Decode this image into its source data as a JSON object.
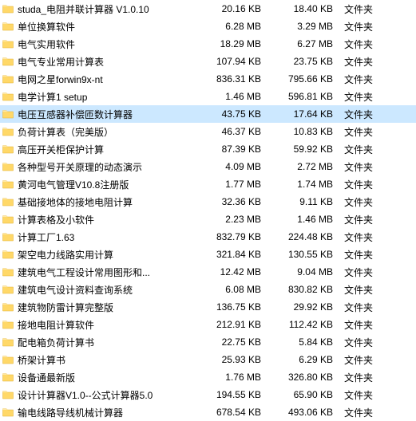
{
  "rows": [
    {
      "name": "studa_电阻并联计算器 V1.0.10",
      "size1": "20.16 KB",
      "size2": "18.40 KB",
      "type": "文件夹",
      "selected": false
    },
    {
      "name": "单位换算软件",
      "size1": "6.28 MB",
      "size2": "3.29 MB",
      "type": "文件夹",
      "selected": false
    },
    {
      "name": "电气实用软件",
      "size1": "18.29 MB",
      "size2": "6.27 MB",
      "type": "文件夹",
      "selected": false
    },
    {
      "name": "电气专业常用计算表",
      "size1": "107.94 KB",
      "size2": "23.75 KB",
      "type": "文件夹",
      "selected": false
    },
    {
      "name": "电网之星forwin9x-nt",
      "size1": "836.31 KB",
      "size2": "795.66 KB",
      "type": "文件夹",
      "selected": false
    },
    {
      "name": "电学计算1 setup",
      "size1": "1.46 MB",
      "size2": "596.81 KB",
      "type": "文件夹",
      "selected": false
    },
    {
      "name": "电压互感器补偿匝数计算器",
      "size1": "43.75 KB",
      "size2": "17.64 KB",
      "type": "文件夹",
      "selected": true
    },
    {
      "name": "负荷计算表（完美版）",
      "size1": "46.37 KB",
      "size2": "10.83 KB",
      "type": "文件夹",
      "selected": false
    },
    {
      "name": "高压开关柜保护计算",
      "size1": "87.39 KB",
      "size2": "59.92 KB",
      "type": "文件夹",
      "selected": false
    },
    {
      "name": "各种型号开关原理的动态演示",
      "size1": "4.09 MB",
      "size2": "2.72 MB",
      "type": "文件夹",
      "selected": false
    },
    {
      "name": "黄河电气管理V10.8注册版",
      "size1": "1.77 MB",
      "size2": "1.74 MB",
      "type": "文件夹",
      "selected": false
    },
    {
      "name": "基础接地体的接地电阻计算",
      "size1": "32.36 KB",
      "size2": "9.11 KB",
      "type": "文件夹",
      "selected": false
    },
    {
      "name": "计算表格及小软件",
      "size1": "2.23 MB",
      "size2": "1.46 MB",
      "type": "文件夹",
      "selected": false
    },
    {
      "name": "计算工厂1.63",
      "size1": "832.79 KB",
      "size2": "224.48 KB",
      "type": "文件夹",
      "selected": false
    },
    {
      "name": "架空电力线路实用计算",
      "size1": "321.84 KB",
      "size2": "130.55 KB",
      "type": "文件夹",
      "selected": false
    },
    {
      "name": "建筑电气工程设计常用图形和...",
      "size1": "12.42 MB",
      "size2": "9.04 MB",
      "type": "文件夹",
      "selected": false
    },
    {
      "name": "建筑电气设计资料查询系统",
      "size1": "6.08 MB",
      "size2": "830.82 KB",
      "type": "文件夹",
      "selected": false
    },
    {
      "name": "建筑物防雷计算完整版",
      "size1": "136.75 KB",
      "size2": "29.92 KB",
      "type": "文件夹",
      "selected": false
    },
    {
      "name": "接地电阻计算软件",
      "size1": "212.91 KB",
      "size2": "112.42 KB",
      "type": "文件夹",
      "selected": false
    },
    {
      "name": "配电箱负荷计算书",
      "size1": "22.75 KB",
      "size2": "5.84 KB",
      "type": "文件夹",
      "selected": false
    },
    {
      "name": "桥架计算书",
      "size1": "25.93 KB",
      "size2": "6.29 KB",
      "type": "文件夹",
      "selected": false
    },
    {
      "name": "设备通最新版",
      "size1": "1.76 MB",
      "size2": "326.80 KB",
      "type": "文件夹",
      "selected": false
    },
    {
      "name": "设计计算器V1.0--公式计算器5.0",
      "size1": "194.55 KB",
      "size2": "65.90 KB",
      "type": "文件夹",
      "selected": false
    },
    {
      "name": "输电线路导线机械计算器",
      "size1": "678.54 KB",
      "size2": "493.06 KB",
      "type": "文件夹",
      "selected": false
    }
  ]
}
